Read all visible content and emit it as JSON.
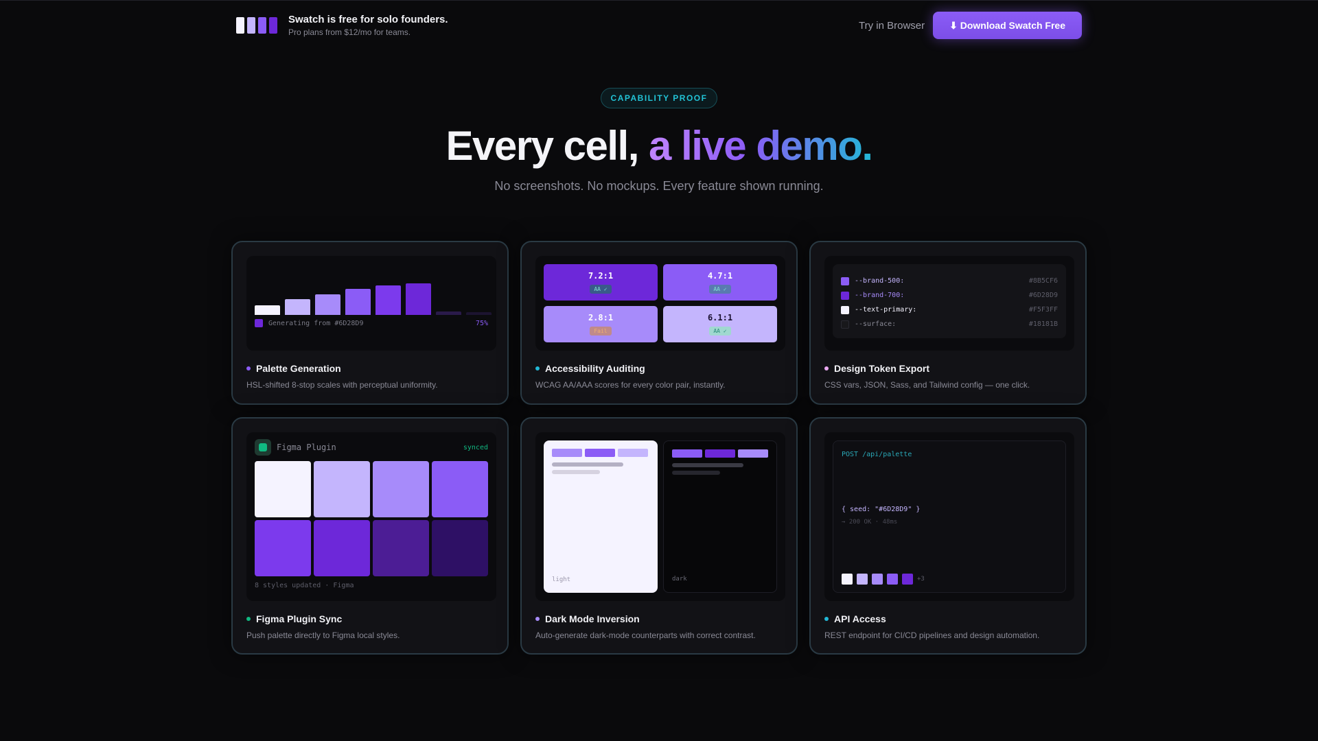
{
  "header": {
    "logo_colors": [
      "#f5f3ff",
      "#c4b5fd",
      "#8b5cf6",
      "#6d28d9"
    ],
    "title": "Swatch is free for solo founders.",
    "subtitle": "Pro plans from $12/mo for teams.",
    "try_label": "Try in Browser",
    "download_label": "⬇ Download Swatch Free"
  },
  "hero": {
    "badge": "CAPABILITY PROOF",
    "title_plain": "Every cell, ",
    "title_gradient": "a live demo.",
    "subtitle": "No screenshots. No mockups. Every feature shown running."
  },
  "cards": [
    {
      "title": "Palette Generation",
      "desc": "HSL-shifted 8-stop scales with perceptual uniformity.",
      "dot_color": "#8b5cf6",
      "demo": {
        "bars": [
          {
            "color": "#f5f3ff",
            "level": 0.3
          },
          {
            "color": "#c4b5fd",
            "level": 0.5
          },
          {
            "color": "#a78bfa",
            "level": 0.65
          },
          {
            "color": "#8b5cf6",
            "level": 0.82
          },
          {
            "color": "#7c3aed",
            "level": 0.93
          },
          {
            "color": "#6d28d9",
            "level": 1.0
          },
          {
            "color": "#2a1a4a",
            "level": 0.1
          },
          {
            "color": "#1c1430",
            "level": 0.08
          }
        ],
        "generating": "Generating from #6D28D9",
        "progress": "75%"
      }
    },
    {
      "title": "Accessibility Auditing",
      "desc": "WCAG AA/AAA scores for every color pair, instantly.",
      "dot_color": "#22b8d6",
      "demo": {
        "cells": [
          {
            "ratio": "7.2:1",
            "badge": "AA ✓",
            "bg": "#6d28d9",
            "fg": "#ffffff",
            "badge_bg": "#3a5a8a",
            "badge_fg": "#7ee0d0"
          },
          {
            "ratio": "4.7:1",
            "badge": "AA ✓",
            "bg": "#8b5cf6",
            "fg": "#ffffff",
            "badge_bg": "#5a7ab0",
            "badge_fg": "#7ee0d0"
          },
          {
            "ratio": "2.8:1",
            "badge": "Fail",
            "bg": "#a78bfa",
            "fg": "#ffffff",
            "badge_bg": "#c08a8a",
            "badge_fg": "#f0b070"
          },
          {
            "ratio": "6.1:1",
            "badge": "AA ✓",
            "bg": "#c4b5fd",
            "fg": "#1a1030",
            "badge_bg": "#a0d8d0",
            "badge_fg": "#2a8a7a"
          }
        ]
      }
    },
    {
      "title": "Design Token Export",
      "desc": "CSS vars, JSON, Sass, and Tailwind config — one click.",
      "dot_color": "#e9a8f0",
      "demo": {
        "tokens": [
          {
            "name": "--brand-500:",
            "hex": "#8B5CF6",
            "color": "#8b5cf6",
            "text_color": "#c4b5fd"
          },
          {
            "name": "--brand-700:",
            "hex": "#6D28D9",
            "color": "#6d28d9",
            "text_color": "#a78bfa"
          },
          {
            "name": "--text-primary:",
            "hex": "#F5F3FF",
            "color": "#f5f3ff",
            "text_color": "#f5f3ff"
          },
          {
            "name": "--surface:",
            "hex": "#18181B",
            "color": "#18181b",
            "text_color": "#8a8a96"
          }
        ]
      }
    },
    {
      "title": "Figma Plugin Sync",
      "desc": "Push palette directly to Figma local styles.",
      "dot_color": "#10b981",
      "demo": {
        "header": "Figma Plugin",
        "status": "synced",
        "swatches": [
          "#f5f3ff",
          "#c4b5fd",
          "#a78bfa",
          "#8b5cf6",
          "#7c3aed",
          "#6d28d9",
          "#4c1d95",
          "#2e1065"
        ],
        "footer": "8 styles updated · Figma"
      }
    },
    {
      "title": "Dark Mode Inversion",
      "desc": "Auto-generate dark-mode counterparts with correct contrast.",
      "dot_color": "#a78bfa",
      "demo": {
        "light_label": "light",
        "dark_label": "dark"
      }
    },
    {
      "title": "API Access",
      "desc": "REST endpoint for CI/CD pipelines and design automation.",
      "dot_color": "#22b8d6",
      "demo": {
        "endpoint": "POST /api/palette",
        "request": "{ seed: \"#6D28D9\" }",
        "response": "→ 200 OK · 48ms",
        "swatches": [
          "#f5f3ff",
          "#c4b5fd",
          "#a78bfa",
          "#8b5cf6",
          "#6d28d9"
        ],
        "more": "+3"
      }
    }
  ]
}
